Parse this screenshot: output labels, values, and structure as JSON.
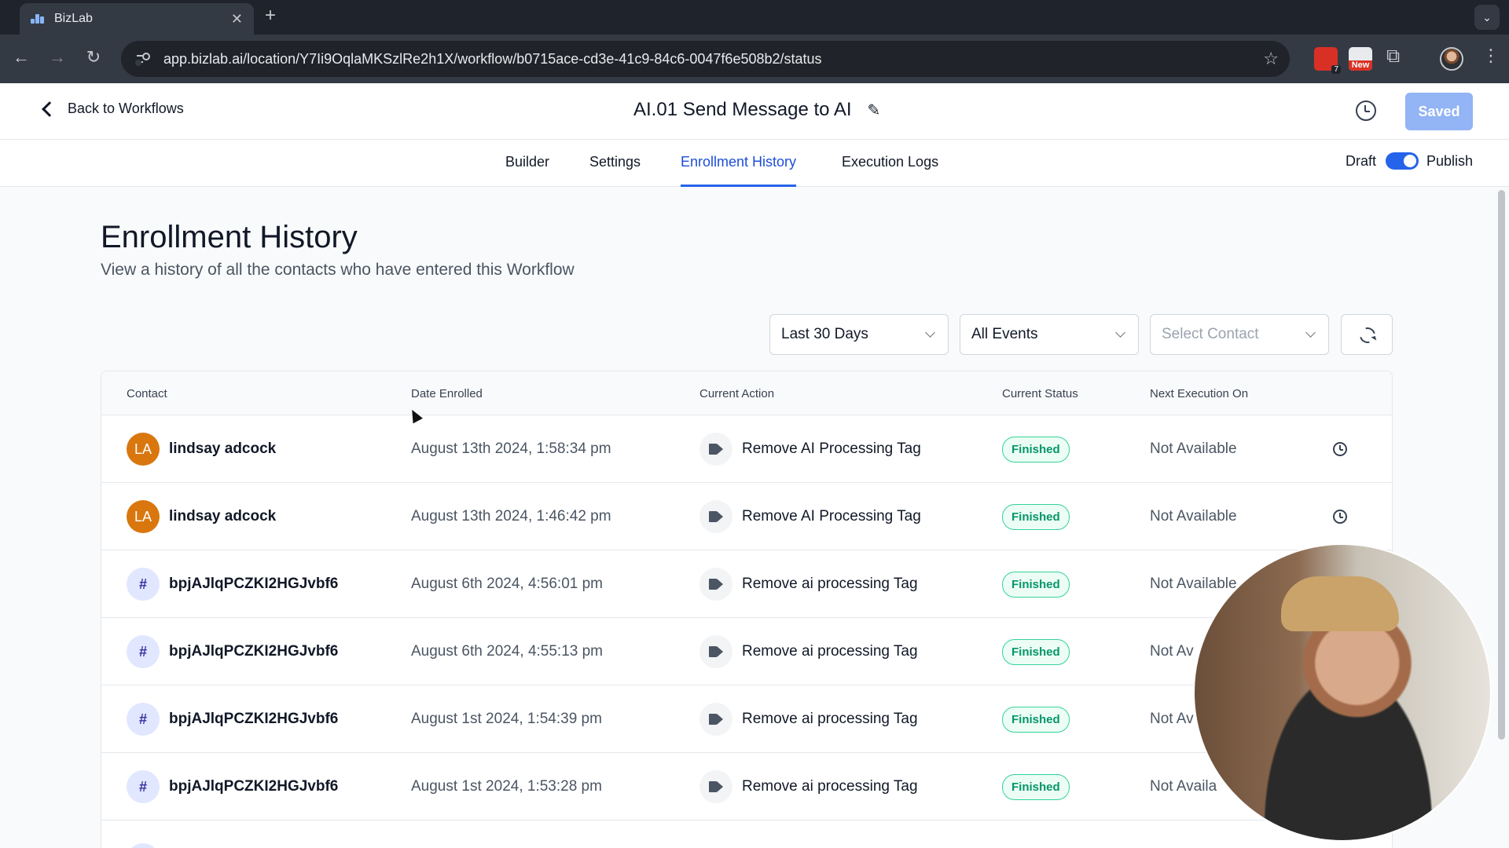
{
  "browser": {
    "tab_title": "BizLab",
    "url": "app.bizlab.ai/location/Y7Ii9OqlaMKSzlRe2h1X/workflow/b0715ace-cd3e-41c9-84c6-0047f6e508b2/status",
    "ext1_badge": "7",
    "ext2_badge": "New"
  },
  "header": {
    "back_label": "Back to Workflows",
    "workflow_title": "AI.01 Send Message to AI",
    "saved_label": "Saved"
  },
  "tabs": {
    "builder": "Builder",
    "settings": "Settings",
    "enrollment_history": "Enrollment History",
    "execution_logs": "Execution Logs",
    "active": "Enrollment History"
  },
  "publish_toggle": {
    "draft_label": "Draft",
    "publish_label": "Publish",
    "is_published": true
  },
  "page": {
    "title": "Enrollment History",
    "subtitle": "View a history of all the contacts who have entered this Workflow"
  },
  "filters": {
    "date_range": "Last 30 Days",
    "events": "All Events",
    "contact_placeholder": "Select Contact"
  },
  "table": {
    "columns": {
      "contact": "Contact",
      "date_enrolled": "Date Enrolled",
      "current_action": "Current Action",
      "current_status": "Current Status",
      "next_execution": "Next Execution On"
    },
    "rows": [
      {
        "avatar": "LA",
        "name": "lindsay adcock",
        "date": "August 13th 2024, 1:58:34 pm",
        "action": "Remove AI Processing Tag",
        "status": "Finished",
        "next": "Not Available"
      },
      {
        "avatar": "LA",
        "name": "lindsay adcock",
        "date": "August 13th 2024, 1:46:42 pm",
        "action": "Remove AI Processing Tag",
        "status": "Finished",
        "next": "Not Available"
      },
      {
        "avatar": "#",
        "name": "bpjAJlqPCZKI2HGJvbf6",
        "date": "August 6th 2024, 4:56:01 pm",
        "action": "Remove ai processing Tag",
        "status": "Finished",
        "next": "Not Available"
      },
      {
        "avatar": "#",
        "name": "bpjAJlqPCZKI2HGJvbf6",
        "date": "August 6th 2024, 4:55:13 pm",
        "action": "Remove ai processing Tag",
        "status": "Finished",
        "next": "Not Av"
      },
      {
        "avatar": "#",
        "name": "bpjAJlqPCZKI2HGJvbf6",
        "date": "August 1st 2024, 1:54:39 pm",
        "action": "Remove ai processing Tag",
        "status": "Finished",
        "next": "Not Av"
      },
      {
        "avatar": "#",
        "name": "bpjAJlqPCZKI2HGJvbf6",
        "date": "August 1st 2024, 1:53:28 pm",
        "action": "Remove ai processing Tag",
        "status": "Finished",
        "next": "Not Availa"
      }
    ]
  },
  "colors": {
    "accent": "#2563eb",
    "status_finished": "#059669",
    "avatar_initials": "#d9770e",
    "saved_button": "#93b4f5"
  }
}
